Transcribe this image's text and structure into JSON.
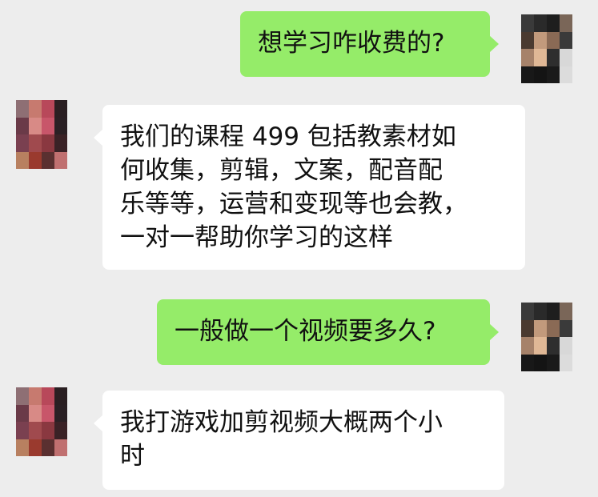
{
  "messages": [
    {
      "direction": "out",
      "text": "想学习咋收费的?"
    },
    {
      "direction": "in",
      "text": "我们的课程 499 包括教素材如\n何收集，剪辑，文案，配音配\n乐等等，运营和变现等也会教，\n一对一帮助你学习的这样"
    },
    {
      "direction": "out",
      "text": "一般做一个视频要多久?"
    },
    {
      "direction": "in",
      "text": "我打游戏加剪视频大概两个小\n时"
    }
  ],
  "avatars": {
    "self": [
      "#3a3a3a",
      "#2a2a2a",
      "#1e1e1e",
      "#7a6658",
      "#4a3a30",
      "#c29a7c",
      "#8a6a55",
      "#3a3a3a",
      "#a6826a",
      "#e0b896",
      "#2e2e2e",
      "#d8d8d8",
      "#181818",
      "#141414",
      "#1a1a1a",
      "#dcdcdc"
    ],
    "contact": [
      "#8e6f74",
      "#c77a6f",
      "#b8485a",
      "#2a1f22",
      "#6a3a48",
      "#d88a86",
      "#c8566a",
      "#2a2024",
      "#7a4050",
      "#a04a4e",
      "#8a3840",
      "#3a2226",
      "#b88060",
      "#9a3a2e",
      "#5a3030",
      "#c07070"
    ]
  }
}
